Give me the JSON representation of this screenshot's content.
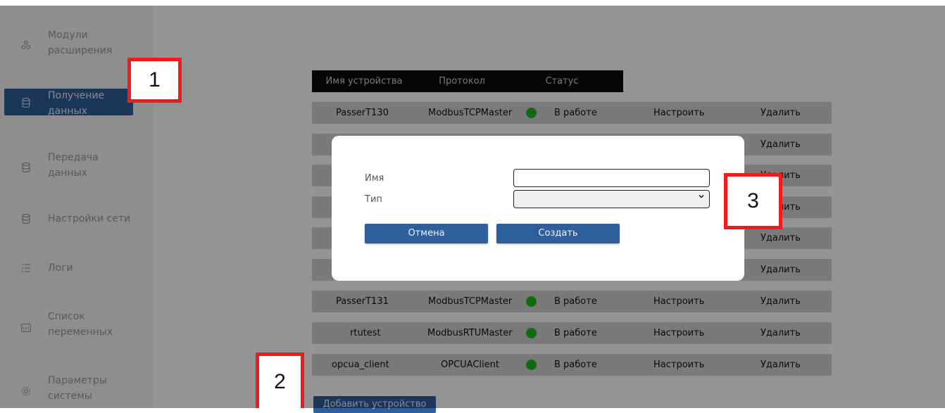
{
  "sidebar": {
    "items": [
      {
        "label": "Модули\nрасширения",
        "icon": "modules-icon",
        "active": false
      },
      {
        "label": "Получение\nданных",
        "icon": "database-icon",
        "active": true
      },
      {
        "label": "Передача\nданных",
        "icon": "database-icon",
        "active": false
      },
      {
        "label": "Настройки сети",
        "icon": "database-icon",
        "active": false
      },
      {
        "label": "Логи",
        "icon": "list-icon",
        "active": false
      },
      {
        "label": "Список\nпеременных",
        "icon": "variables-icon",
        "active": false
      },
      {
        "label": "Параметры\nсистемы",
        "icon": "gear-icon",
        "active": false
      }
    ]
  },
  "table": {
    "headers": [
      "Имя устройства",
      "Протокол",
      "Статус"
    ],
    "rows": [
      {
        "name": "PasserT130",
        "protocol": "ModbusTCPMaster",
        "status": "В работе",
        "configure": "Настроить",
        "delete": "Удалить"
      },
      {
        "name": "",
        "protocol": "",
        "status": "",
        "configure": "",
        "delete": "Удалить"
      },
      {
        "name": "",
        "protocol": "",
        "status": "",
        "configure": "",
        "delete": "Удалить"
      },
      {
        "name": "",
        "protocol": "",
        "status": "",
        "configure": "",
        "delete": "Удалить"
      },
      {
        "name": "",
        "protocol": "",
        "status": "",
        "configure": "",
        "delete": "Удалить"
      },
      {
        "name": "",
        "protocol": "",
        "status": "",
        "configure": "",
        "delete": "Удалить"
      },
      {
        "name": "PasserT131",
        "protocol": "ModbusTCPMaster",
        "status": "В работе",
        "configure": "Настроить",
        "delete": "Удалить"
      },
      {
        "name": "rtutest",
        "protocol": "ModbusRTUMaster",
        "status": "В работе",
        "configure": "Настроить",
        "delete": "Удалить"
      },
      {
        "name": "opcua_client",
        "protocol": "OPCUAClient",
        "status": "В работе",
        "configure": "Настроить",
        "delete": "Удалить"
      }
    ],
    "add_button": "Добавить устройство"
  },
  "modal": {
    "name_label": "Имя",
    "name_value": "",
    "type_label": "Тип",
    "type_value": "",
    "cancel_label": "Отмена",
    "create_label": "Создать"
  },
  "callouts": [
    "1",
    "2",
    "3"
  ],
  "colors": {
    "accent": "#2e5d99",
    "status_ok": "#1cb91c",
    "callout_border": "#ee1c1c"
  }
}
